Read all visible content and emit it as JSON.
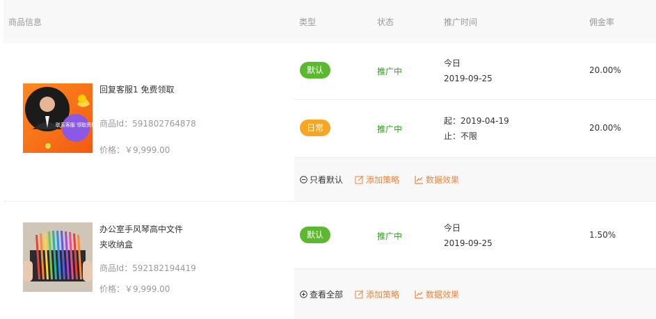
{
  "columns": {
    "product": "商品信息",
    "type": "类型",
    "status": "状态",
    "time": "推广时间",
    "rate": "佣金率"
  },
  "products": [
    {
      "name": "回复客服1 免费领取",
      "id_label": "商品Id：591802764878",
      "price_label": "价格：￥9,999.00",
      "thumb_text": "联系客服 领取资料",
      "strategies": [
        {
          "type": "默认",
          "type_color": "#5cb82f",
          "status": "推广中",
          "time_line1": "今日",
          "time_line2": "2019-09-25",
          "rate": "20.00%"
        },
        {
          "type": "日常",
          "type_color": "#f5a623",
          "status": "推广中",
          "time_line1": "起：2019-04-19",
          "time_line2": "止：不限",
          "rate": "20.00%"
        }
      ],
      "actions": {
        "toggle": "只看默认",
        "toggle_icon": "minus-circle-icon",
        "add": "添加策略",
        "stats": "数据效果"
      }
    },
    {
      "name": "办公室手风琴高中文件夹收纳盒",
      "id_label": "商品Id：592182194419",
      "price_label": "价格：￥9,999.00",
      "strategies": [
        {
          "type": "默认",
          "type_color": "#5cb82f",
          "status": "推广中",
          "time_line1": "今日",
          "time_line2": "2019-09-25",
          "rate": "1.50%"
        }
      ],
      "actions": {
        "toggle": "查看全部",
        "toggle_icon": "plus-circle-icon",
        "add": "添加策略",
        "stats": "数据效果"
      }
    }
  ],
  "colors": {
    "accent_orange": "#f0843c",
    "status_green": "#2f9e1f",
    "badge_green": "#5cb82f",
    "badge_orange": "#f5a623"
  }
}
